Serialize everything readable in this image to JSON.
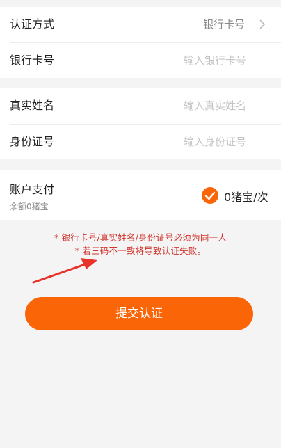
{
  "auth_method": {
    "label": "认证方式",
    "value": "银行卡号",
    "chevron_icon": "chevron-right-icon"
  },
  "bank_card": {
    "label": "银行卡号",
    "placeholder": "输入银行卡号"
  },
  "real_name": {
    "label": "真实姓名",
    "placeholder": "输入真实姓名"
  },
  "id_number": {
    "label": "身份证号",
    "placeholder": "输入身份证号"
  },
  "payment": {
    "label": "账户支付",
    "balance": "余额0猪宝",
    "price": "0猪宝/次",
    "checked": true,
    "check_icon": "check-circle-icon"
  },
  "notes": {
    "line1": "* 银行卡号/真实姓名/身份证号必须为同一人",
    "line2": "* 若三码不一致将导致认证失败。"
  },
  "submit": {
    "label": "提交认证"
  },
  "colors": {
    "accent": "#fa6508",
    "warning": "#d0342c",
    "background": "#f4f4f4"
  }
}
